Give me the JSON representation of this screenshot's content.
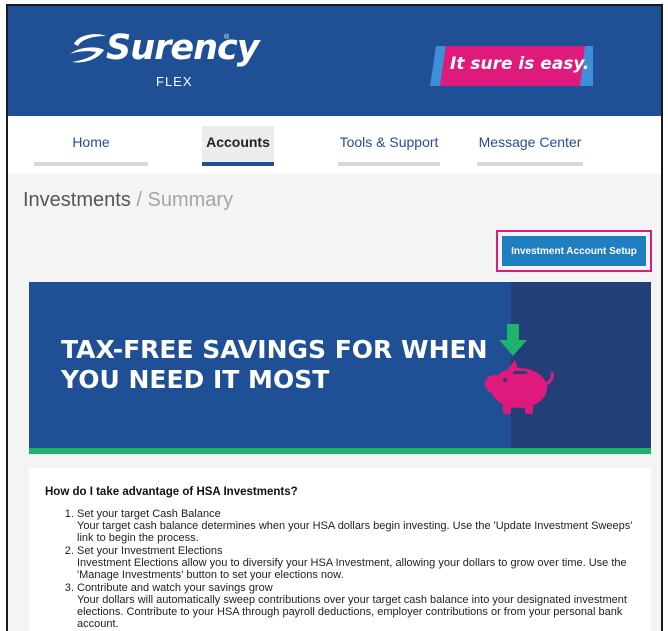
{
  "brand": {
    "name": "Surency",
    "tm": "®",
    "sub": "FLEX",
    "tagline": "It sure is easy.",
    "colors": {
      "navy": "#1f4f95",
      "pink": "#e0197d",
      "green": "#1db36b",
      "button": "#1f7ec0"
    }
  },
  "nav": {
    "items": [
      {
        "label": "Home"
      },
      {
        "label": "Accounts",
        "active": true
      },
      {
        "label": "Tools & Support"
      },
      {
        "label": "Message Center"
      }
    ]
  },
  "page": {
    "title": "Investments",
    "separator": "/",
    "subtitle": "Summary",
    "setup_button": "Investment Account Setup"
  },
  "banner": {
    "line1": "TAX-FREE SAVINGS FOR WHEN",
    "line2": "YOU NEED IT MOST",
    "icon": "piggy-bank-icon"
  },
  "info": {
    "heading": "How do I take advantage of HSA Investments?",
    "steps": [
      {
        "title": "Set your target Cash Balance",
        "desc": "Your target cash balance determines when your HSA dollars begin investing. Use the 'Update Investment Sweeps' link to begin the process."
      },
      {
        "title": "Set your Investment Elections",
        "desc": "Investment Elections allow you to diversify your HSA Investment, allowing your dollars to grow over time. Use the 'Manage Investments' button to set your elections now."
      },
      {
        "title": "Contribute and watch your savings grow",
        "desc": "Your dollars will automatically sweep contributions over your target cash balance into your designated investment elections. Contribute to your HSA through payroll deductions, employer contributions or from your personal bank account."
      }
    ]
  }
}
